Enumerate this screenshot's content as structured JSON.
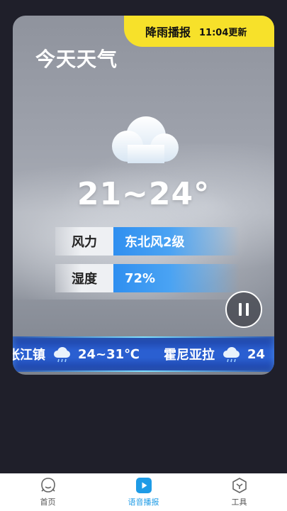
{
  "ribbon": {
    "title": "降雨播报",
    "updated": "11:04更新"
  },
  "card": {
    "title": "今天天气",
    "icon": "cloud-icon",
    "temperature": "21~24°",
    "wind": {
      "label": "风力",
      "value": "东北风2级"
    },
    "humidity": {
      "label": "湿度",
      "value": "72%"
    }
  },
  "ticker": [
    {
      "city": "张江镇",
      "icon": "rain-cloud-icon",
      "temp": "24~31℃"
    },
    {
      "city": "霍尼亚拉",
      "icon": "rain-cloud-icon",
      "temp": "24"
    }
  ],
  "tabs": [
    {
      "label": "首页",
      "icon": "home-icon",
      "active": false
    },
    {
      "label": "语音播报",
      "icon": "play-icon",
      "active": true
    },
    {
      "label": "工具",
      "icon": "cube-icon",
      "active": false
    }
  ],
  "colors": {
    "accent": "#1e9be6",
    "ribbon": "#f7e12a",
    "ticker": "#2a5fd1"
  }
}
